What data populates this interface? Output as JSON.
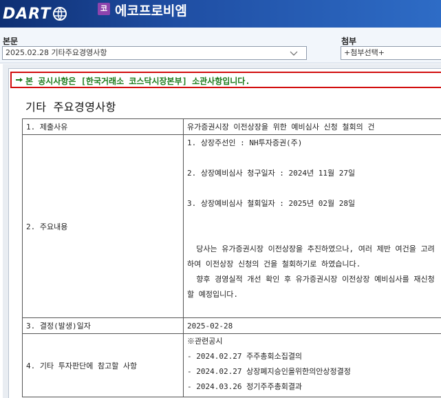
{
  "header": {
    "logo_text": "DART",
    "company_badge": "코",
    "company_name": "에코프로비엠"
  },
  "selectors": {
    "main_label": "본문",
    "main_value": "2025.02.28  기타주요경영사항",
    "attach_label": "첨부",
    "attach_value": "+첨부선택+"
  },
  "notice": "본 공시사항은 [한국거래소 코스닥시장본부] 소관사항입니다.",
  "doc_title": "기타 주요경영사항",
  "table": {
    "row1": {
      "label": "1. 제출사유",
      "value": "유가증권시장 이전상장을 위한 예비심사 신청 철회의 건"
    },
    "row2": {
      "label": "2. 주요내용",
      "lines": [
        "1. 상장주선인 : NH투자증권(주)",
        "2. 상장예비심사 청구일자 : 2024년 11월 27일",
        "3. 상장예비심사 철회일자 : 2025년 02월 28일"
      ],
      "para1": "  당사는 유가증권시장 이전상장을 추진하였으나, 여러 제반 여건을 고려하여 이전상장 신청의 건을 철회하기로 하였습니다.",
      "para2": "  향후 경영실적 개선 확인 후 유가증권시장 이전상장 예비심사를 재신청할 예정입니다."
    },
    "row3": {
      "label": "3. 결정(발생)일자",
      "value": "2025-02-28"
    },
    "row4": {
      "label": "4. 기타 투자판단에 참고할 사항",
      "lines": [
        "※관련공시",
        "- 2024.02.27 주주총회소집결의",
        "- 2024.02.27 상장폐지승인을위한의안상정결정",
        "- 2024.03.26 정기주주총회결과"
      ]
    }
  }
}
